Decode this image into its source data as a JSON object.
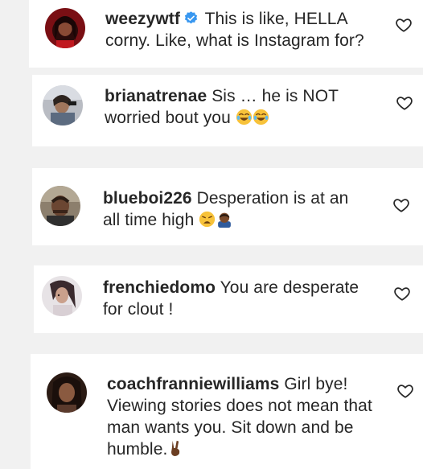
{
  "comments": [
    {
      "username": "weezywtf",
      "text": "This is like, HELLA corny. Like, what is Instagram for?",
      "verified": true,
      "emojis": []
    },
    {
      "username": "brianatrenae",
      "text": "Sis … he is NOT worried bout you",
      "verified": false,
      "emojis": [
        "face-with-tears-of-joy",
        "face-with-tears-of-joy"
      ]
    },
    {
      "username": "blueboi226",
      "text": "Desperation is at an all time high",
      "verified": false,
      "emojis": [
        "weary-face",
        "man-bowing"
      ]
    },
    {
      "username": "frenchiedomo",
      "text": "You are desperate for clout !",
      "verified": false,
      "emojis": []
    },
    {
      "username": "coachfranniewilliams",
      "text": "Girl bye! Viewing stories does not mean that man wants you. Sit down and be humble.",
      "verified": false,
      "emojis": [
        "victory-hand"
      ]
    }
  ],
  "icons": {
    "like": "heart-outline-icon",
    "verified": "verified-badge-icon"
  },
  "colors": {
    "background": "#f1f1f1",
    "card": "#ffffff",
    "text": "#262626",
    "verified_blue": "#3897f0"
  }
}
